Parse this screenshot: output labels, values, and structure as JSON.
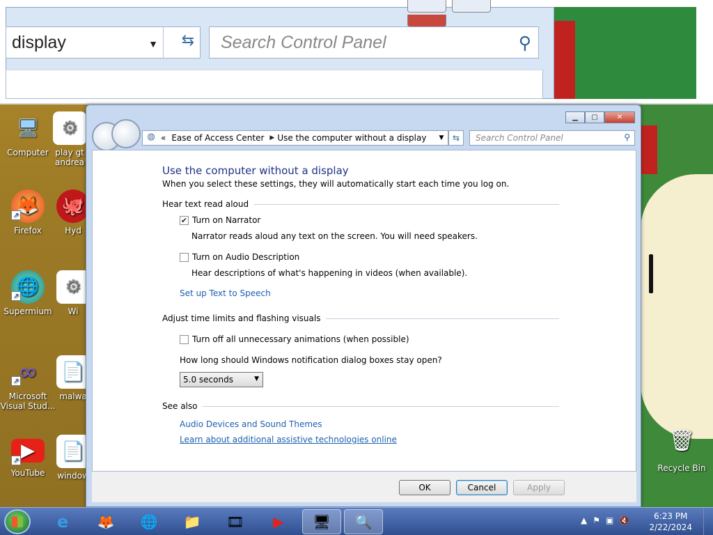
{
  "background_window": {
    "address_text": "display",
    "search_placeholder": "Search Control Panel"
  },
  "desktop_icons": [
    {
      "label": "Computer",
      "glyph": "🖥"
    },
    {
      "label": "play gt andrea",
      "glyph": "⚙"
    },
    {
      "label": "Firefox",
      "glyph": "🦊"
    },
    {
      "label": "Hyd",
      "glyph": "🐙"
    },
    {
      "label": "Supermium",
      "glyph": "🌐"
    },
    {
      "label": "Wi",
      "glyph": "⚙"
    },
    {
      "label": "Microsoft Visual Stud...",
      "glyph": "∞"
    },
    {
      "label": "malwa",
      "glyph": "📄"
    },
    {
      "label": "YouTube",
      "glyph": "▶"
    },
    {
      "label": "window",
      "glyph": "📄"
    }
  ],
  "window": {
    "breadcrumb": [
      "Ease of Access Center",
      "Use the computer without a display"
    ],
    "breadcrumb_prefix": "«",
    "search_placeholder": "Search Control Panel",
    "title": "Use the computer without a display",
    "subtitle": "When you select these settings, they will automatically start each time you log on.",
    "sections": {
      "hear": {
        "heading": "Hear text read aloud",
        "narrator_label": "Turn on Narrator",
        "narrator_checked": true,
        "narrator_desc": "Narrator reads aloud any text on the screen. You will need speakers.",
        "audio_desc_label": "Turn on Audio Description",
        "audio_desc_checked": false,
        "audio_desc_desc": "Hear descriptions of what's happening in videos (when available).",
        "tts_link": "Set up Text to Speech"
      },
      "time": {
        "heading": "Adjust time limits and flashing visuals",
        "animations_label": "Turn off all unnecessary animations (when possible)",
        "animations_checked": false,
        "notify_question": "How long should Windows notification dialog boxes stay open?",
        "notify_value": "5.0 seconds"
      },
      "see_also": {
        "heading": "See also",
        "link1": "Audio Devices and Sound Themes",
        "link2": "Learn about additional assistive technologies online"
      }
    },
    "buttons": {
      "ok": "OK",
      "cancel": "Cancel",
      "apply": "Apply"
    }
  },
  "recycle_bin": {
    "label": "Recycle Bin",
    "glyph": "🗑"
  },
  "taskbar": {
    "apps": [
      {
        "name": "ie",
        "glyph": "e"
      },
      {
        "name": "firefox",
        "glyph": "🦊"
      },
      {
        "name": "supermium",
        "glyph": "🌐"
      },
      {
        "name": "explorer",
        "glyph": "📁"
      },
      {
        "name": "media",
        "glyph": "🎞"
      },
      {
        "name": "youtube",
        "glyph": "▶"
      },
      {
        "name": "control-panel",
        "glyph": "🖥"
      },
      {
        "name": "magnifier",
        "glyph": "🔍"
      }
    ],
    "time": "6:23 PM",
    "date": "2/22/2024"
  },
  "colors": {
    "link": "#1b5fb1",
    "title": "#1e3287"
  }
}
